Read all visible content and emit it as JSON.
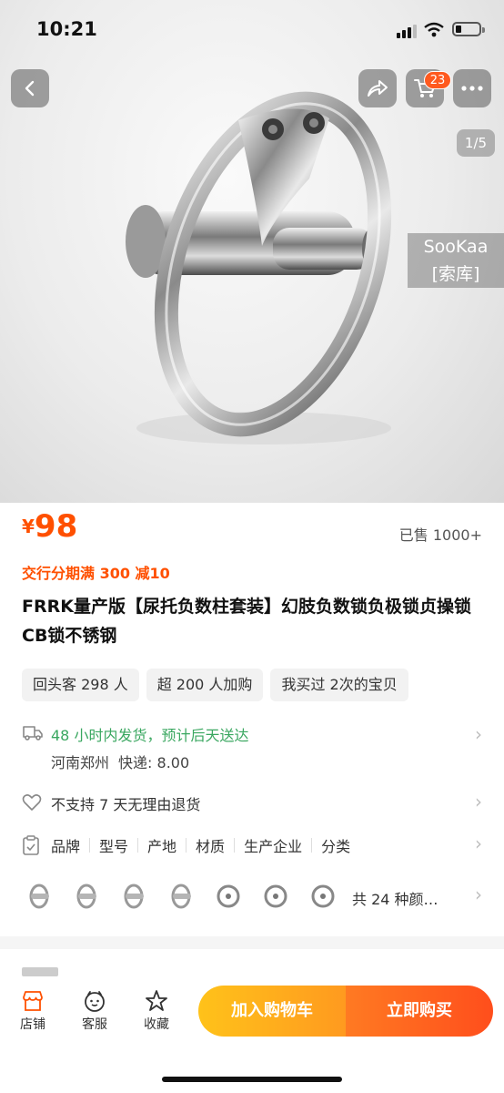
{
  "status_bar": {
    "time": "10:21"
  },
  "hero": {
    "page_indicator": "1/5",
    "cart_count": "23",
    "watermark_line1": "SooKaa",
    "watermark_line2": "[索库]"
  },
  "price": {
    "currency": "¥",
    "value": "98",
    "sold": "已售 1000+"
  },
  "promo": "交行分期满 300 减10",
  "title": "FRRK量产版【尿托负数柱套装】幻肢负数锁负极锁贞操锁CB锁不锈钢",
  "tags": [
    "回头客 298 人",
    "超 200 人加购",
    "我买过 2次的宝贝"
  ],
  "shipping": {
    "line": "48 小时内发货，预计后天送达",
    "origin": "河南郑州",
    "express_label": "快递:",
    "express_fee": "8.00"
  },
  "returns": "不支持 7 天无理由退货",
  "attributes": [
    "品牌",
    "型号",
    "产地",
    "材质",
    "生产企业",
    "分类"
  ],
  "variants": {
    "summary": "共 24 种颜…"
  },
  "bottom_bar": {
    "shop": "店铺",
    "service": "客服",
    "favorite": "收藏",
    "add_to_cart": "加入购物车",
    "buy_now": "立即购买"
  },
  "colors": {
    "accent": "#ff5000",
    "ship_green": "#3aa760",
    "cart_btn": "#ffb21d",
    "buy_btn": "#ff5a1f"
  }
}
